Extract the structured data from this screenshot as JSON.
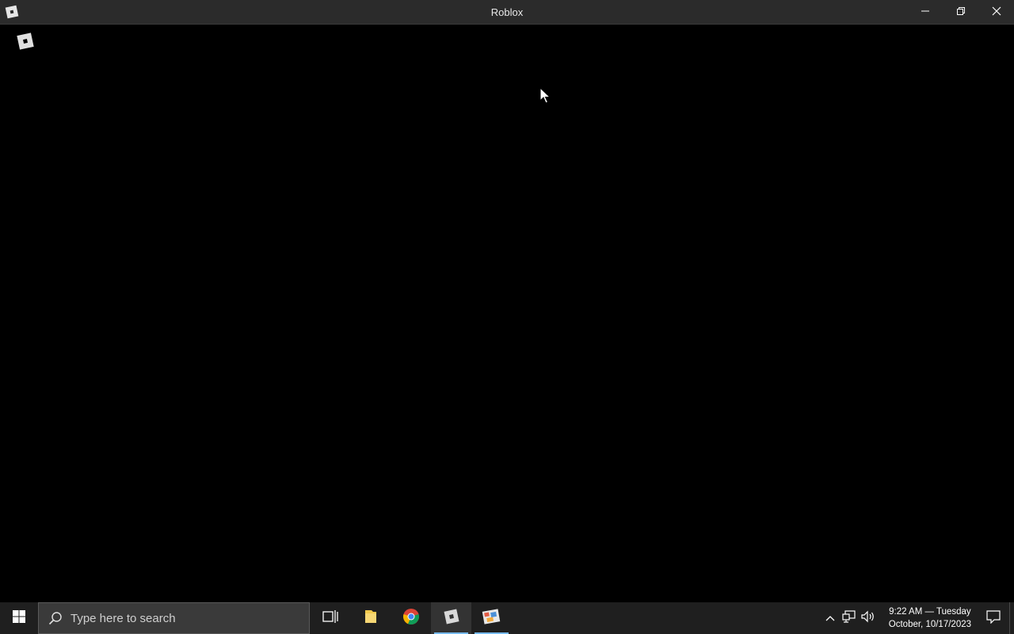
{
  "window": {
    "title": "Roblox",
    "app_icon": "roblox-logo-icon",
    "controls": {
      "minimize_icon": "minimize-icon",
      "restore_icon": "restore-icon",
      "close_icon": "close-icon"
    }
  },
  "content": {
    "loading_icon": "roblox-logo-icon",
    "background": "#000000"
  },
  "taskbar": {
    "start_icon": "windows-start-icon",
    "search": {
      "placeholder": "Type here to search",
      "icon": "search-icon"
    },
    "apps": [
      {
        "name": "task-view",
        "icon": "task-view-icon",
        "active": false,
        "running": false
      },
      {
        "name": "file-explorer",
        "icon": "folder-icon",
        "active": false,
        "running": false
      },
      {
        "name": "chrome",
        "icon": "chrome-icon",
        "active": false,
        "running": false
      },
      {
        "name": "roblox",
        "icon": "roblox-logo-icon",
        "active": true,
        "running": true
      },
      {
        "name": "roblox-studio",
        "icon": "roblox-player-icon",
        "active": false,
        "running": true
      }
    ],
    "tray": {
      "icons": [
        "chevron-up-icon",
        "network-icon",
        "volume-icon"
      ],
      "time_line": "9:22 AM — Tuesday",
      "date_line": "October, 10/17/2023",
      "notification_icon": "notification-icon"
    },
    "accent_color": "#76b9ed"
  }
}
